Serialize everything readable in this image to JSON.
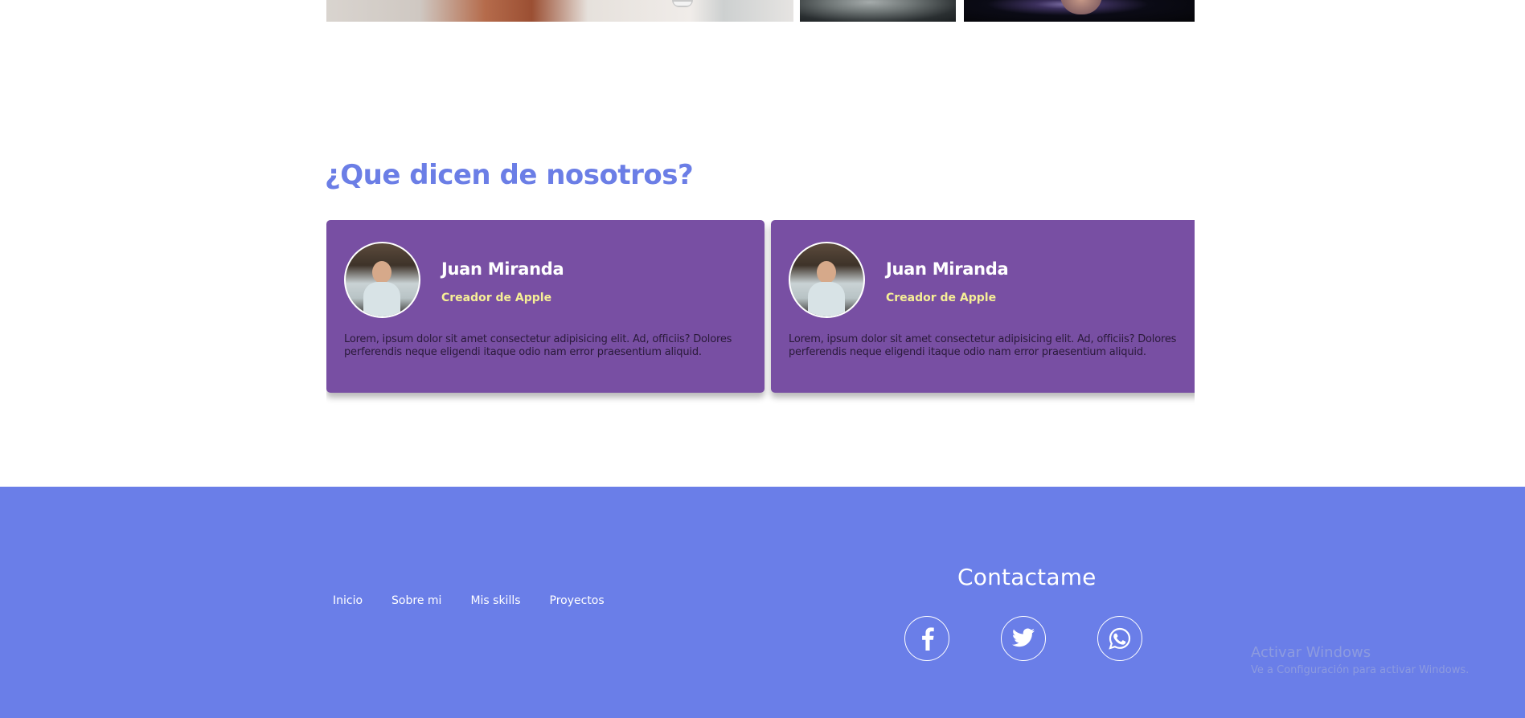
{
  "testimonials": {
    "title": "¿Que dicen de nosotros?",
    "cards": [
      {
        "name": "Juan Miranda",
        "role": "Creador de Apple",
        "text": "Lorem, ipsum dolor sit amet consectetur adipisicing elit. Ad, officiis? Dolores perferendis neque eligendi itaque odio nam error praesentium aliquid."
      },
      {
        "name": "Juan Miranda",
        "role": "Creador de Apple",
        "text": "Lorem, ipsum dolor sit amet consectetur adipisicing elit. Ad, officiis? Dolores perferendis neque eligendi itaque odio nam error praesentium aliquid."
      }
    ]
  },
  "footer": {
    "nav": [
      "Inicio",
      "Sobre mi",
      "Mis skills",
      "Proyectos"
    ],
    "contact_title": "Contactame",
    "social": [
      "facebook-icon",
      "twitter-icon",
      "whatsapp-icon"
    ]
  },
  "watermark": {
    "title": "Activar Windows",
    "subtitle": "Ve a Configuración para activar Windows."
  },
  "colors": {
    "accent_blue": "#6a7ee8",
    "heading_blue": "#6b7ee6",
    "card_purple": "#784fa3",
    "role_yellow": "#f6ef96"
  }
}
